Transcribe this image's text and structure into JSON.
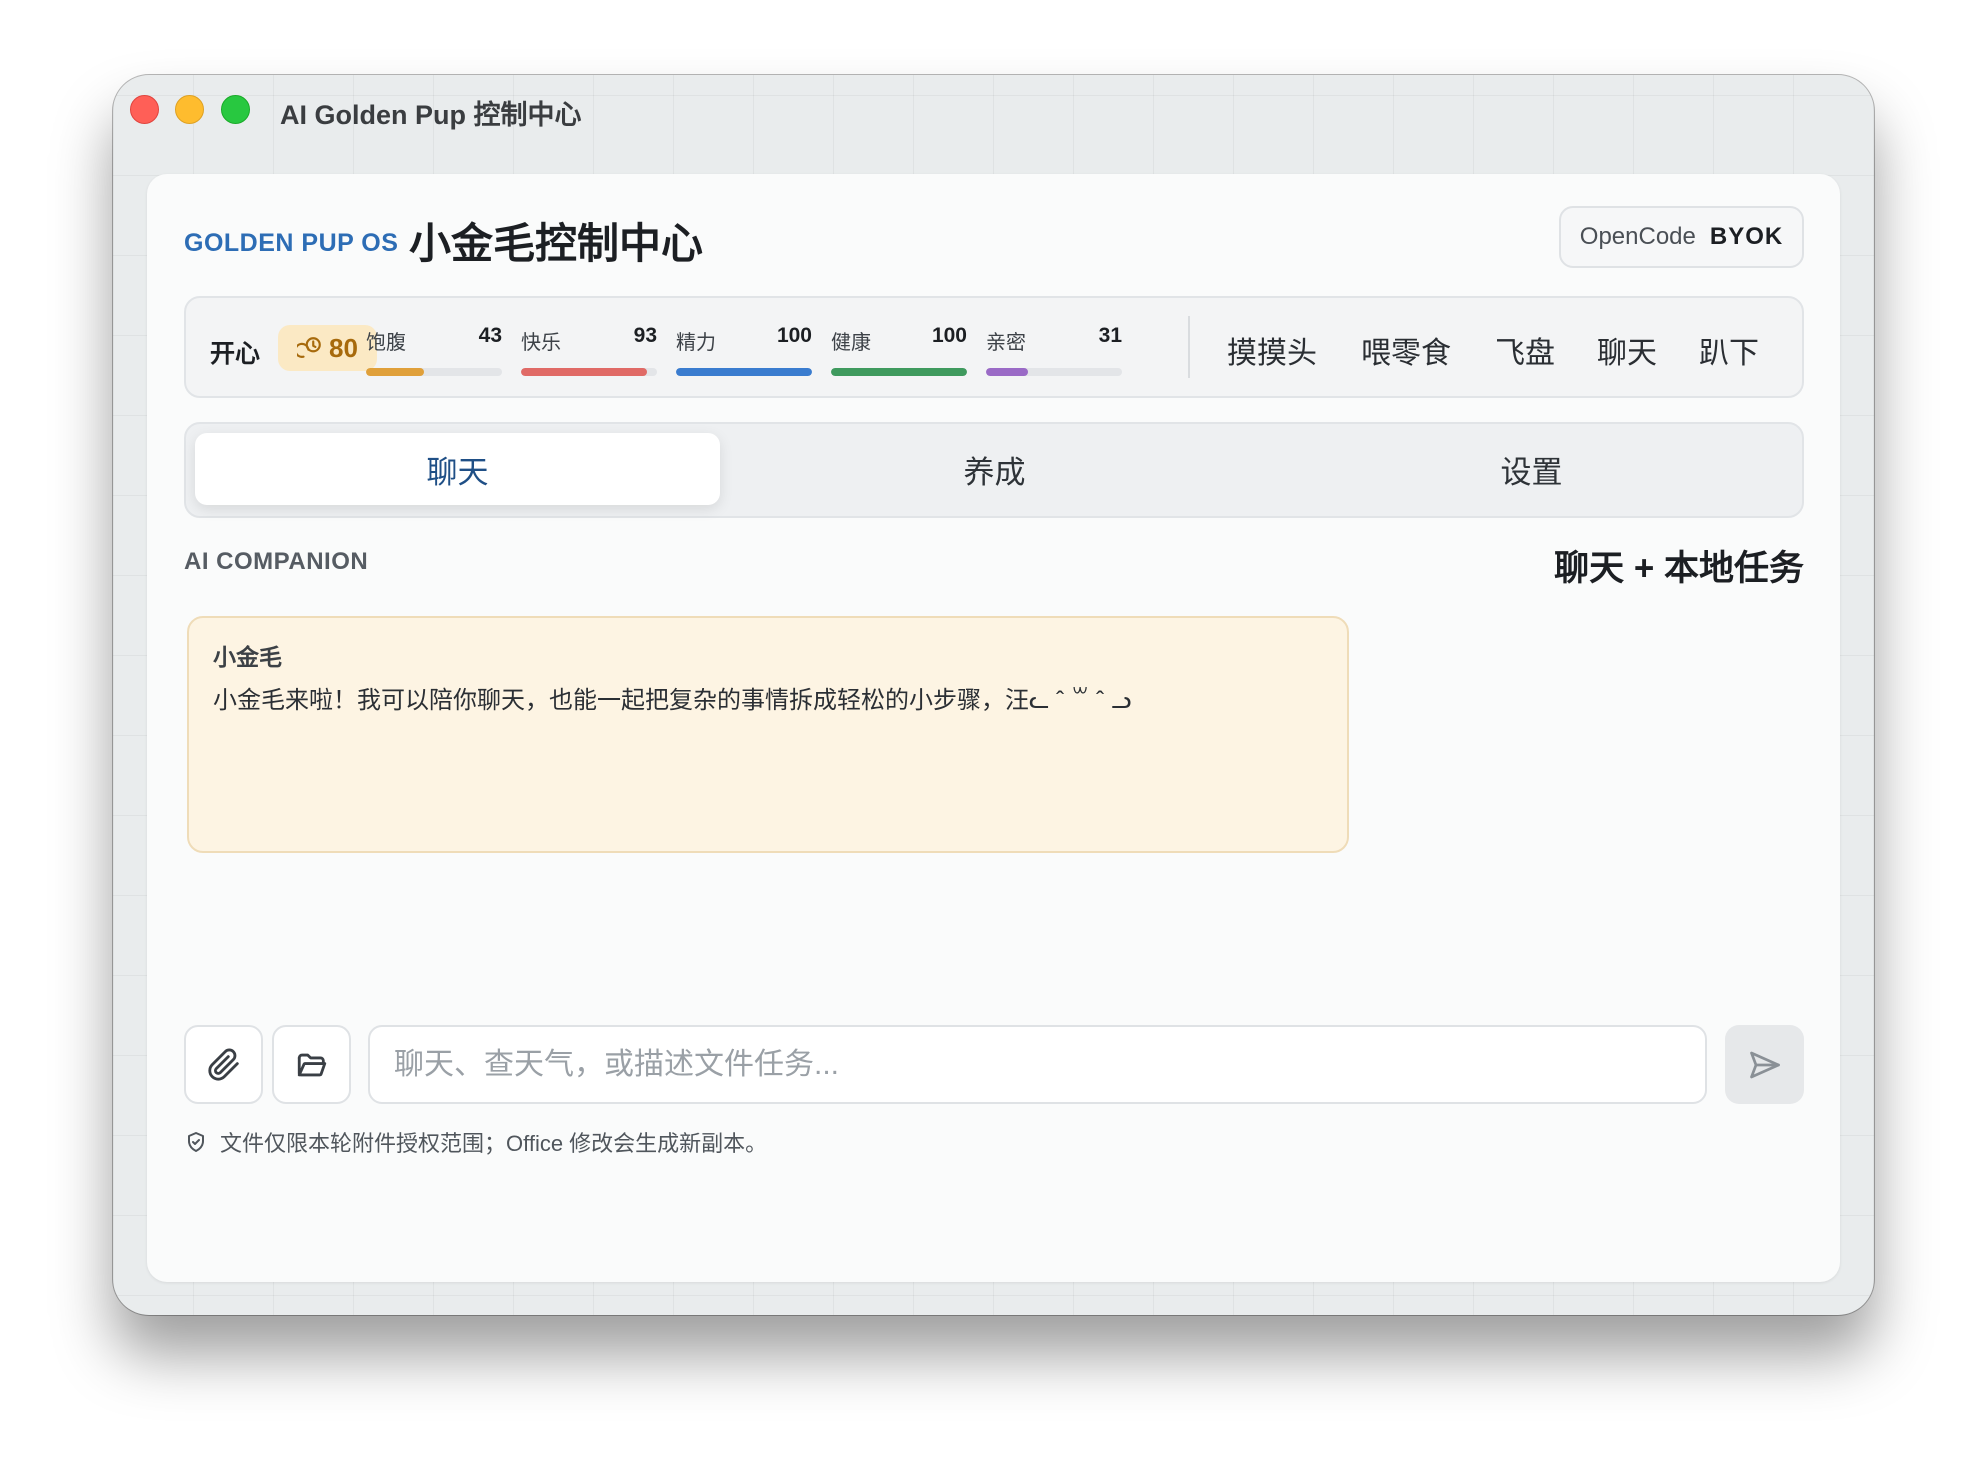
{
  "window": {
    "title": "AI Golden Pup 控制中心"
  },
  "header": {
    "brand": "GOLDEN PUP OS",
    "title": "小金毛控制中心",
    "provider": {
      "name": "OpenCode",
      "mode": "BYOK"
    }
  },
  "status": {
    "mood_label": "开心",
    "mood_value": "80",
    "stats": [
      {
        "label": "饱腹",
        "value": "43",
        "pct": 43,
        "color": "#e0a03a"
      },
      {
        "label": "快乐",
        "value": "93",
        "pct": 93,
        "color": "#e06a66"
      },
      {
        "label": "精力",
        "value": "100",
        "pct": 100,
        "color": "#3a7ccf"
      },
      {
        "label": "健康",
        "value": "100",
        "pct": 100,
        "color": "#3f9a5e"
      },
      {
        "label": "亲密",
        "value": "31",
        "pct": 31,
        "color": "#9a6ac6"
      }
    ],
    "actions": [
      "摸摸头",
      "喂零食",
      "飞盘",
      "聊天",
      "趴下"
    ]
  },
  "tabs": [
    {
      "label": "聊天",
      "active": true
    },
    {
      "label": "养成",
      "active": false
    },
    {
      "label": "设置",
      "active": false
    }
  ],
  "section": {
    "label": "AI COMPANION",
    "right_title": "聊天 + 本地任务"
  },
  "messages": [
    {
      "sender": "小金毛",
      "text": "小金毛来啦！我可以陪你聊天，也能一起把复杂的事情拆成轻松的小步骤，汪ᓚ ˆ ꒳ ˆ ᓗ"
    }
  ],
  "composer": {
    "placeholder": "聊天、查天气，或描述文件任务...",
    "value": "",
    "note": "文件仅限本轮附件授权范围；Office 修改会生成新副本。"
  }
}
